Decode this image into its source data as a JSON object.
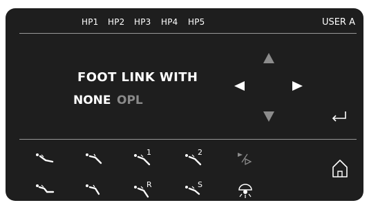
{
  "header": {
    "handpieces": [
      "HP1",
      "HP2",
      "HP3",
      "HP4",
      "HP5"
    ],
    "user": "USER A"
  },
  "main": {
    "title": "FOOT LINK WITH",
    "options": [
      {
        "label": "NONE",
        "selected": true
      },
      {
        "label": "OPL",
        "selected": false
      }
    ]
  },
  "nav": {
    "up": "arrow-up-icon",
    "down": "arrow-down-icon",
    "left": "arrow-left-icon",
    "right": "arrow-right-icon",
    "enter": "enter-icon"
  },
  "tools": {
    "row1": [
      {
        "icon": "chair-position-1-icon",
        "label": ""
      },
      {
        "icon": "chair-position-2-icon",
        "label": ""
      },
      {
        "icon": "chair-memory-icon",
        "label": "1"
      },
      {
        "icon": "chair-memory-icon",
        "label": "2"
      },
      {
        "icon": "play-pause-icon",
        "label": ""
      }
    ],
    "row2": [
      {
        "icon": "chair-position-3-icon",
        "label": ""
      },
      {
        "icon": "chair-position-4-icon",
        "label": ""
      },
      {
        "icon": "chair-return-icon",
        "label": "R"
      },
      {
        "icon": "chair-spit-icon",
        "label": "S"
      },
      {
        "icon": "operating-light-icon",
        "label": ""
      }
    ],
    "home": "home-icon"
  },
  "colors": {
    "panel": "#1e1e1e",
    "text_active": "#ffffff",
    "text_inactive": "#8a8a8a",
    "arrow_inactive": "#8c8c8c"
  }
}
